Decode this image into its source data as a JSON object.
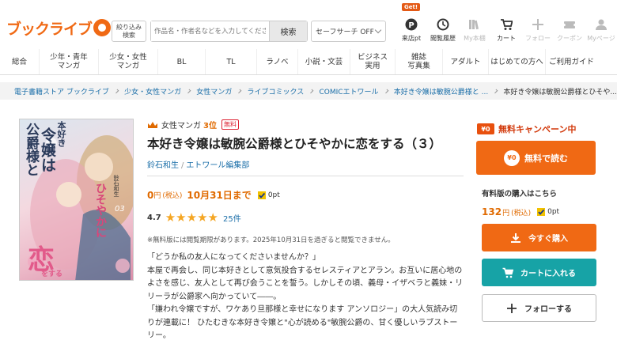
{
  "header": {
    "logo_text": "ブックライブ",
    "category_button": "絞り込み\n検索",
    "search_placeholder": "作品名・作者名などを入力してください",
    "search_button": "検索",
    "safe_search": "セーフサーチ OFF",
    "icons": [
      {
        "label": "来店pt",
        "icon": "point-icon",
        "badge": "Get!",
        "enabled": true
      },
      {
        "label": "閲覧履歴",
        "icon": "history-icon",
        "enabled": true
      },
      {
        "label": "My本棚",
        "icon": "bookshelf-icon",
        "enabled": false
      },
      {
        "label": "カート",
        "icon": "cart-icon",
        "enabled": true
      },
      {
        "label": "フォロー",
        "icon": "plus-icon",
        "enabled": false
      },
      {
        "label": "クーポン",
        "icon": "coupon-icon",
        "enabled": false
      },
      {
        "label": "Myページ",
        "icon": "user-icon",
        "enabled": false
      }
    ]
  },
  "nav": [
    "総合",
    "少年・青年\nマンガ",
    "少女・女性\nマンガ",
    "BL",
    "TL",
    "ラノベ",
    "小説・文芸",
    "ビジネス\n実用",
    "雑誌\n写真集",
    "アダルト",
    "はじめての方へ",
    "ご利用ガイド"
  ],
  "breadcrumb": [
    "電子書籍ストア ブックライブ",
    "少女・女性マンガ",
    "女性マンガ",
    "ライブコミックス",
    "COMICエトワール",
    "本好き令嬢は敏腕公爵様と ...",
    "本好き令嬢は敏腕公爵様とひそや..."
  ],
  "cover": {
    "title_lines": [
      "本好き",
      "令嬢は",
      "公爵様と",
      "恋"
    ],
    "vertical_text": "ひそやかに",
    "author": "鈴石和生",
    "volume": "03",
    "sub": "をする"
  },
  "product": {
    "genre": "女性マンガ",
    "rank": "3位",
    "free_badge": "無料",
    "title": "本好き令嬢は敏腕公爵様とひそやかに恋をする（３）",
    "author": "鈴石和生",
    "publisher": "エトワール編集部",
    "price": "0",
    "price_unit": "円",
    "tax": "(税込)",
    "until": "10月31日まで",
    "points": "0pt",
    "rating": "4.7",
    "rating_value": 4.7,
    "review_count": "25件",
    "note": "※無料版には閲覧期限があります。2025年10月31日を過ぎると閲覧できません。",
    "description": [
      "「どうか私の友人になってくださいませんか？」",
      "本屋で再会し、同じ本好きとして意気投合するセレスティアとアラン。お互いに居心地のよさを感じ、友人として再び会うことを誓う。しかしその頃、義母・イザベラと義妹・リリーラが公爵家へ向かっていて――。",
      "「嫌われ令嬢ですが、ワケあり旦那様と幸せになります アンソロジー」の大人気読み切りが連載に！ ひたむきな本好き令嬢と\"心が読める\"敏腕公爵の、甘く優しいラブストーリー。"
    ]
  },
  "sidebar": {
    "campaign_badge": "¥0",
    "campaign_text": "無料キャンペーン中",
    "free_read_coin": "¥0",
    "free_read_button": "無料で読む",
    "paid_heading": "有料版の購入はこちら",
    "paid_price": "132",
    "paid_unit": "円",
    "paid_tax": "(税込)",
    "paid_points": "0pt",
    "buy_button": "今すぐ購入",
    "cart_button": "カートに入れる",
    "follow_button": "フォローする"
  },
  "colors": {
    "brand": "#f06914",
    "link": "#1a6ea8",
    "cart": "#17a3a6",
    "price": "#e06a00",
    "star": "#f5a623"
  }
}
